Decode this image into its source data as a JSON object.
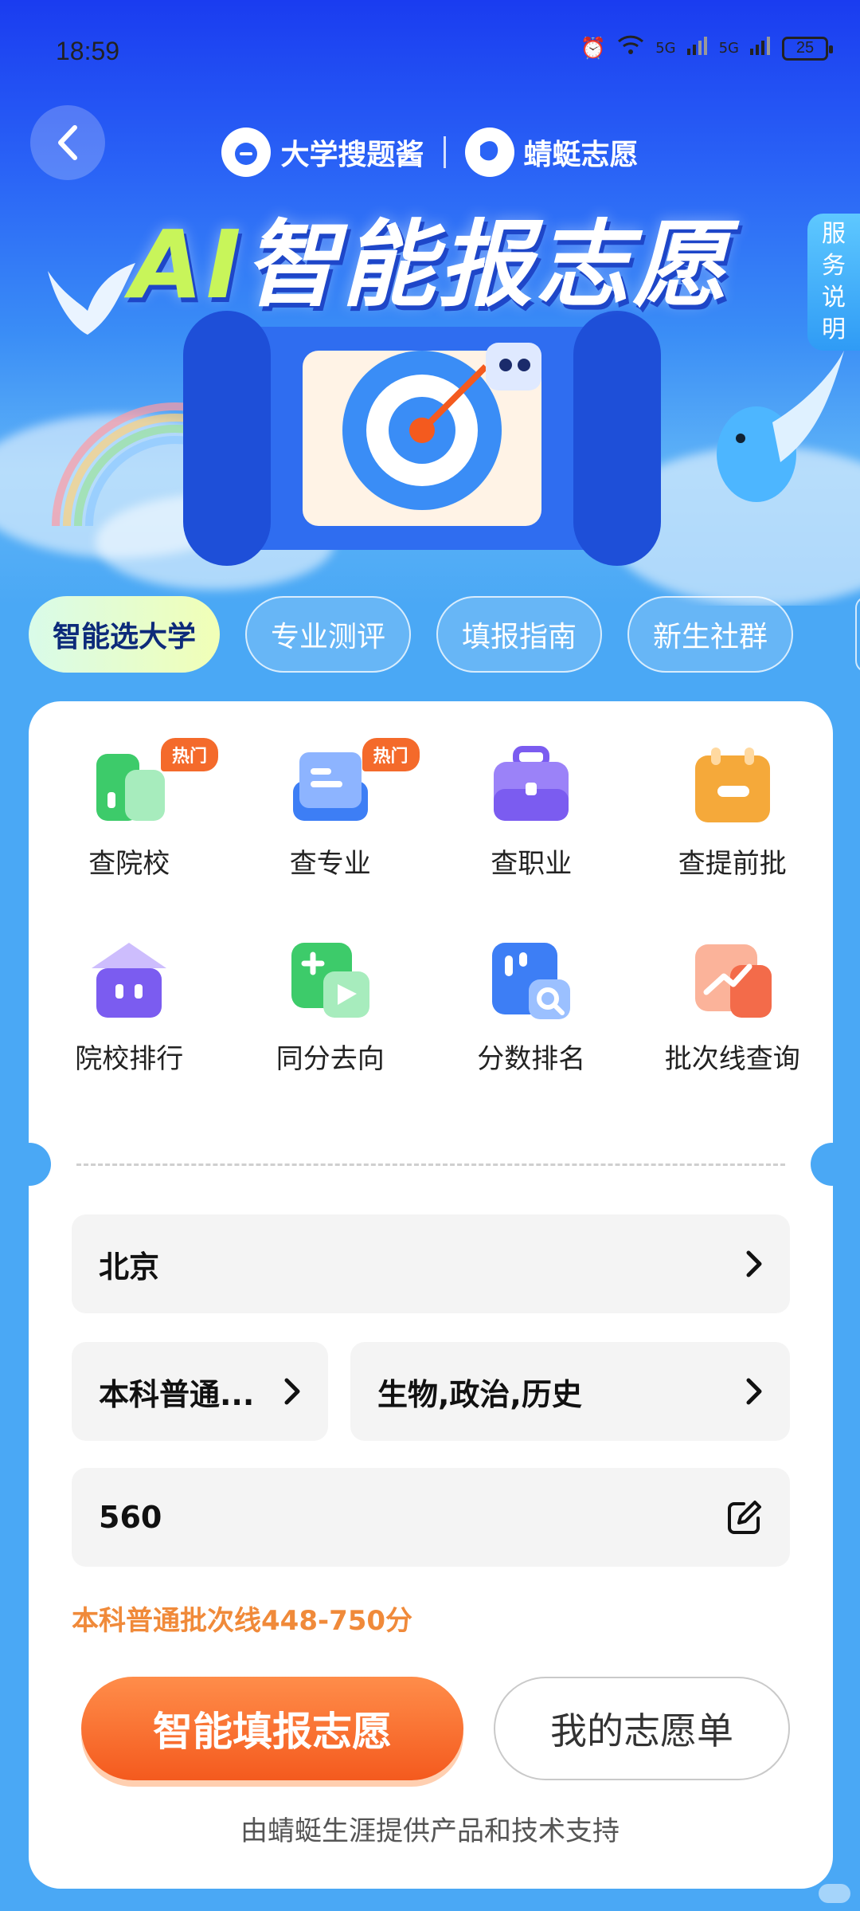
{
  "status_bar": {
    "time": "18:59",
    "signal1": "5G",
    "signal2": "5G",
    "battery": "25"
  },
  "header": {
    "brand1": "大学搜题酱",
    "brand2": "蜻蜓志愿",
    "title_ai": "AI",
    "title_rest": "智能报志愿",
    "service_tab": [
      "服",
      "务",
      "说",
      "明"
    ]
  },
  "tabs": [
    {
      "label": "智能选大学",
      "active": true
    },
    {
      "label": "专业测评",
      "active": false
    },
    {
      "label": "填报指南",
      "active": false
    },
    {
      "label": "新生社群",
      "active": false
    }
  ],
  "grid": [
    {
      "label": "查院校",
      "icon": "school-icon",
      "badge": "热门",
      "color": "#3dcb6a"
    },
    {
      "label": "查专业",
      "icon": "major-book-icon",
      "badge": "热门",
      "color": "#3d7ef5"
    },
    {
      "label": "查职业",
      "icon": "briefcase-icon",
      "badge": "",
      "color": "#7b5cf0"
    },
    {
      "label": "查提前批",
      "icon": "calendar-icon",
      "badge": "",
      "color": "#f5a93a"
    },
    {
      "label": "院校排行",
      "icon": "institution-building-icon",
      "badge": "",
      "color": "#7b5cf0"
    },
    {
      "label": "同分去向",
      "icon": "same-score-icon",
      "badge": "",
      "color": "#3dcb6a"
    },
    {
      "label": "分数排名",
      "icon": "score-rank-icon",
      "badge": "",
      "color": "#3d7ef5"
    },
    {
      "label": "批次线查询",
      "icon": "batch-line-icon",
      "badge": "",
      "color": "#f36b4a"
    }
  ],
  "form": {
    "province": "北京",
    "batch": "本科普通...",
    "subjects": "生物,政治,历史",
    "score": "560",
    "cutoff_note": "本科普通批次线448-750分"
  },
  "actions": {
    "primary": "智能填报志愿",
    "secondary": "我的志愿单"
  },
  "footer_note": "由蜻蜓生涯提供产品和技术支持",
  "colors": {
    "accent_orange": "#f45a1e",
    "background_blue": "#4aa8f5",
    "cutoff_text": "#f08a3a"
  }
}
